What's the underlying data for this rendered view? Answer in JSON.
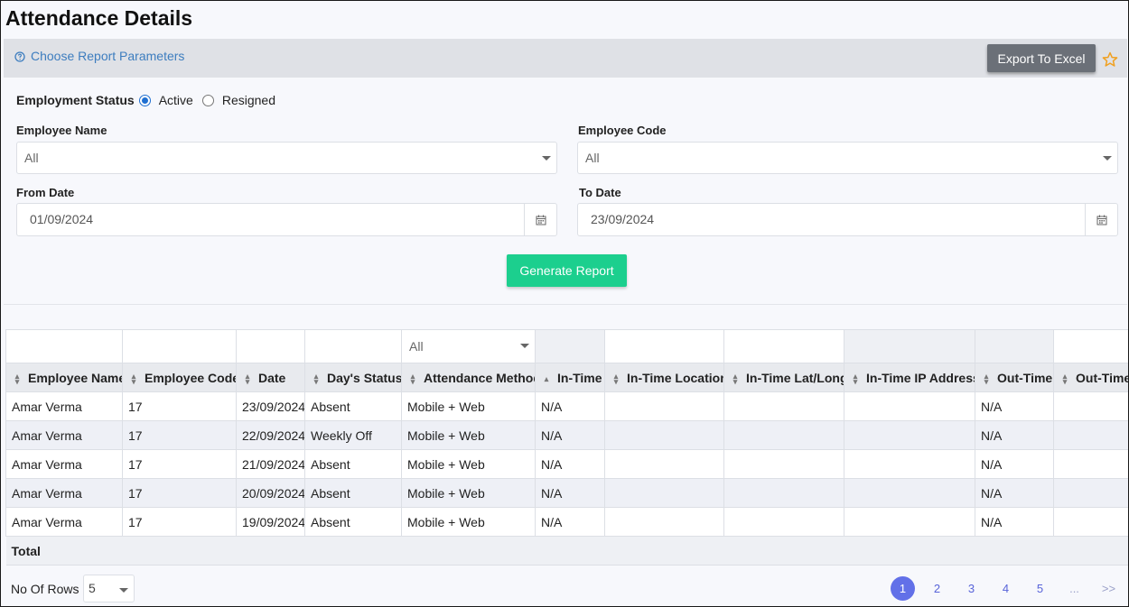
{
  "page": {
    "title": "Attendance Details"
  },
  "param_bar": {
    "link_label": "Choose Report Parameters",
    "export_label": "Export To Excel"
  },
  "form": {
    "employment_status": {
      "label": "Employment Status",
      "options": [
        "Active",
        "Resigned"
      ],
      "selected": "Active"
    },
    "employee_name": {
      "label": "Employee Name",
      "value": "All"
    },
    "employee_code": {
      "label": "Employee Code",
      "value": "All"
    },
    "from_date": {
      "label": "From Date",
      "value": "01/09/2024"
    },
    "to_date": {
      "label": "To Date",
      "value": "23/09/2024"
    },
    "generate_label": "Generate Report"
  },
  "grid": {
    "filter": {
      "method_value": "All"
    },
    "columns": [
      "Employee Name",
      "Employee Code",
      "Date",
      "Day's Status",
      "Attendance Method",
      "In-Time",
      "In-Time Location",
      "In-Time Lat/Long",
      "In-Time IP Address",
      "Out-Time",
      "Out-Time"
    ],
    "rows": [
      [
        "Amar Verma",
        "17",
        "23/09/2024",
        "Absent",
        "Mobile + Web",
        "N/A",
        "",
        "",
        "",
        "N/A",
        ""
      ],
      [
        "Amar Verma",
        "17",
        "22/09/2024",
        "Weekly Off",
        "Mobile + Web",
        "N/A",
        "",
        "",
        "",
        "N/A",
        ""
      ],
      [
        "Amar Verma",
        "17",
        "21/09/2024",
        "Absent",
        "Mobile + Web",
        "N/A",
        "",
        "",
        "",
        "N/A",
        ""
      ],
      [
        "Amar Verma",
        "17",
        "20/09/2024",
        "Absent",
        "Mobile + Web",
        "N/A",
        "",
        "",
        "",
        "N/A",
        ""
      ],
      [
        "Amar Verma",
        "17",
        "19/09/2024",
        "Absent",
        "Mobile + Web",
        "N/A",
        "",
        "",
        "",
        "N/A",
        ""
      ]
    ],
    "total_label": "Total"
  },
  "footer": {
    "rows_label": "No Of Rows :",
    "rows_value": "5",
    "pages": [
      "1",
      "2",
      "3",
      "4",
      "5",
      "...",
      ">>"
    ],
    "current_page": "1"
  },
  "colors": {
    "accent": "#1ccf8e",
    "export": "#6b7078",
    "page_active": "#6270e8",
    "link": "#3d7dbf",
    "star": "#f0a020"
  },
  "icons": {
    "param": "help-circle-icon",
    "star": "star-icon",
    "calendar": "calendar-icon",
    "sort": "sort-icon",
    "caret": "caret-down-icon"
  }
}
